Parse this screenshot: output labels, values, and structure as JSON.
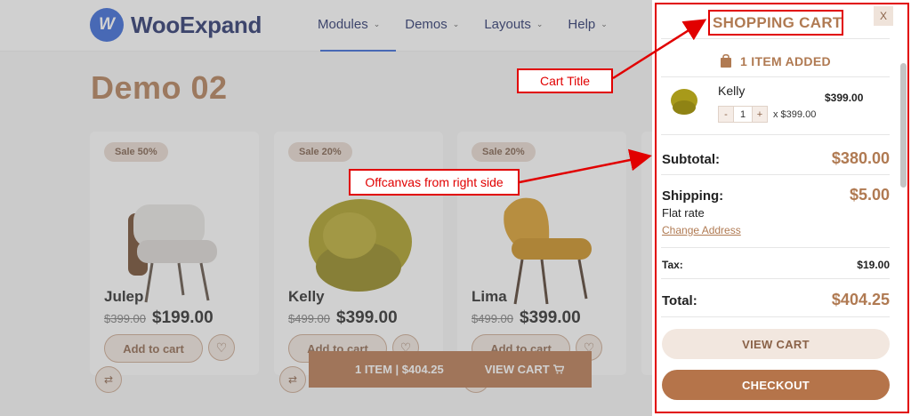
{
  "header": {
    "logo_mark": "W",
    "logo_text": "WooExpand",
    "nav": [
      "Modules",
      "Demos",
      "Layouts",
      "Help"
    ]
  },
  "page": {
    "title": "Demo 02"
  },
  "products": [
    {
      "sale": "Sale 50%",
      "name": "Julep",
      "old_price": "$399.00",
      "price": "$199.00",
      "add_label": "Add to cart",
      "color": "#e9e6e3"
    },
    {
      "sale": "Sale 20%",
      "name": "Kelly",
      "old_price": "$499.00",
      "price": "$399.00",
      "add_label": "Add to cart",
      "color": "#a89a1a"
    },
    {
      "sale": "Sale 20%",
      "name": "Lima",
      "old_price": "$499.00",
      "price": "$399.00",
      "add_label": "Add to cart",
      "color": "#d99a22"
    }
  ],
  "floating_cart": {
    "count_total": "1 ITEM | $404.25",
    "view_label": "VIEW CART"
  },
  "cart": {
    "close": "X",
    "title": "SHOPPING CART",
    "added": "1 ITEM ADDED",
    "item": {
      "name": "Kelly",
      "price": "$399.00",
      "qty": "1",
      "minus": "-",
      "plus": "+",
      "each": "x $399.00"
    },
    "subtotal_label": "Subtotal:",
    "subtotal": "$380.00",
    "shipping_label": "Shipping:",
    "shipping": "$5.00",
    "shipping_method": "Flat rate",
    "change_address": "Change Address",
    "tax_label": "Tax:",
    "tax": "$19.00",
    "total_label": "Total:",
    "total": "$404.25",
    "view_cart": "VIEW CART",
    "checkout": "CHECKOUT"
  },
  "annotations": {
    "cart_title": "Cart Title",
    "offcanvas": "Offcanvas from right side",
    "color": "#e10000"
  }
}
